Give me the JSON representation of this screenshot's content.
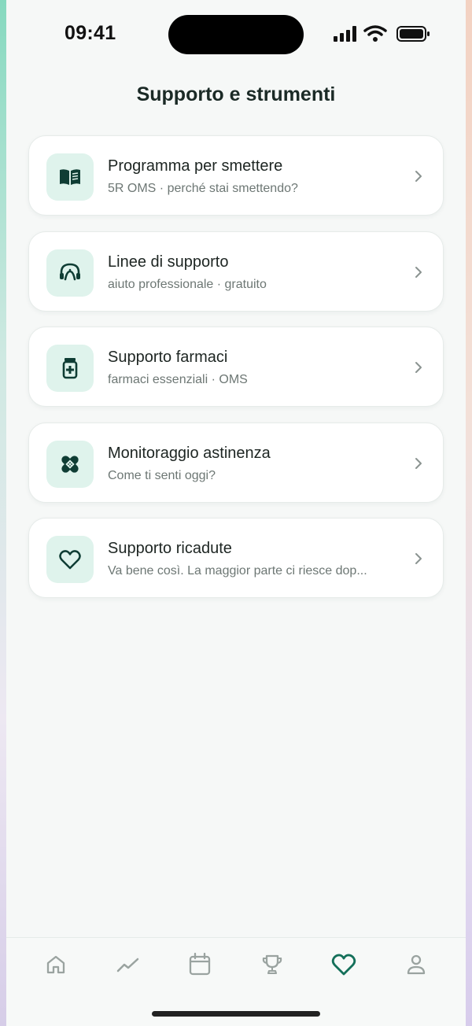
{
  "status_bar": {
    "time": "09:41"
  },
  "header": {
    "title": "Supporto e strumenti"
  },
  "cards": [
    {
      "title": "Programma per smettere",
      "subtitle": "5R OMS · perché stai smettendo?",
      "icon": "book-icon"
    },
    {
      "title": "Linee di supporto",
      "subtitle": "aiuto professionale · gratuito",
      "icon": "headset-icon"
    },
    {
      "title": "Supporto farmaci",
      "subtitle": "farmaci essenziali · OMS",
      "icon": "medicine-bottle-icon"
    },
    {
      "title": "Monitoraggio astinenza",
      "subtitle": "Come ti senti oggi?",
      "icon": "bandage-icon"
    },
    {
      "title": "Supporto ricadute",
      "subtitle": "Va bene così. La maggior parte ci riesce dop...",
      "icon": "heart-icon"
    }
  ],
  "tab_bar": {
    "items": [
      {
        "icon": "home-icon",
        "active": false
      },
      {
        "icon": "trend-chart-icon",
        "active": false
      },
      {
        "icon": "calendar-icon",
        "active": false
      },
      {
        "icon": "trophy-icon",
        "active": false
      },
      {
        "icon": "heart-icon",
        "active": true
      },
      {
        "icon": "profile-icon",
        "active": false
      }
    ]
  },
  "colors": {
    "accent": "#14705a",
    "icon_bg": "#dff3ec",
    "icon_dark": "#0f3d34",
    "inactive_tab": "#9aa3a0",
    "background": "#f6f8f7"
  }
}
